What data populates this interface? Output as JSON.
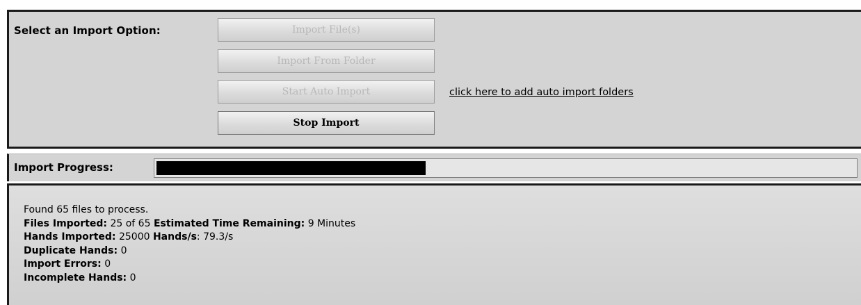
{
  "import_options": {
    "label": "Select an Import Option:",
    "buttons": {
      "import_files": "Import File(s)",
      "import_folder": "Import From Folder",
      "start_auto": "Start Auto Import",
      "stop": "Stop Import"
    },
    "auto_folders_link": "click here to add auto import folders"
  },
  "progress": {
    "label": "Import Progress:",
    "fraction": 0.385
  },
  "log": {
    "found_line": "Found 65 files to process.",
    "files_imported_label": "Files Imported:",
    "files_imported_value": "25 of 65",
    "time_remaining_label": "Estimated Time Remaining:",
    "time_remaining_value": "9 Minutes",
    "hands_imported_label": "Hands Imported:",
    "hands_imported_value": "25000",
    "hands_per_sec_label": "Hands/s",
    "hands_per_sec_value": ": 79.3/s",
    "duplicate_label": "Duplicate Hands:",
    "duplicate_value": "0",
    "errors_label": "Import Errors:",
    "errors_value": "0",
    "incomplete_label": "Incomplete Hands:",
    "incomplete_value": "0"
  }
}
